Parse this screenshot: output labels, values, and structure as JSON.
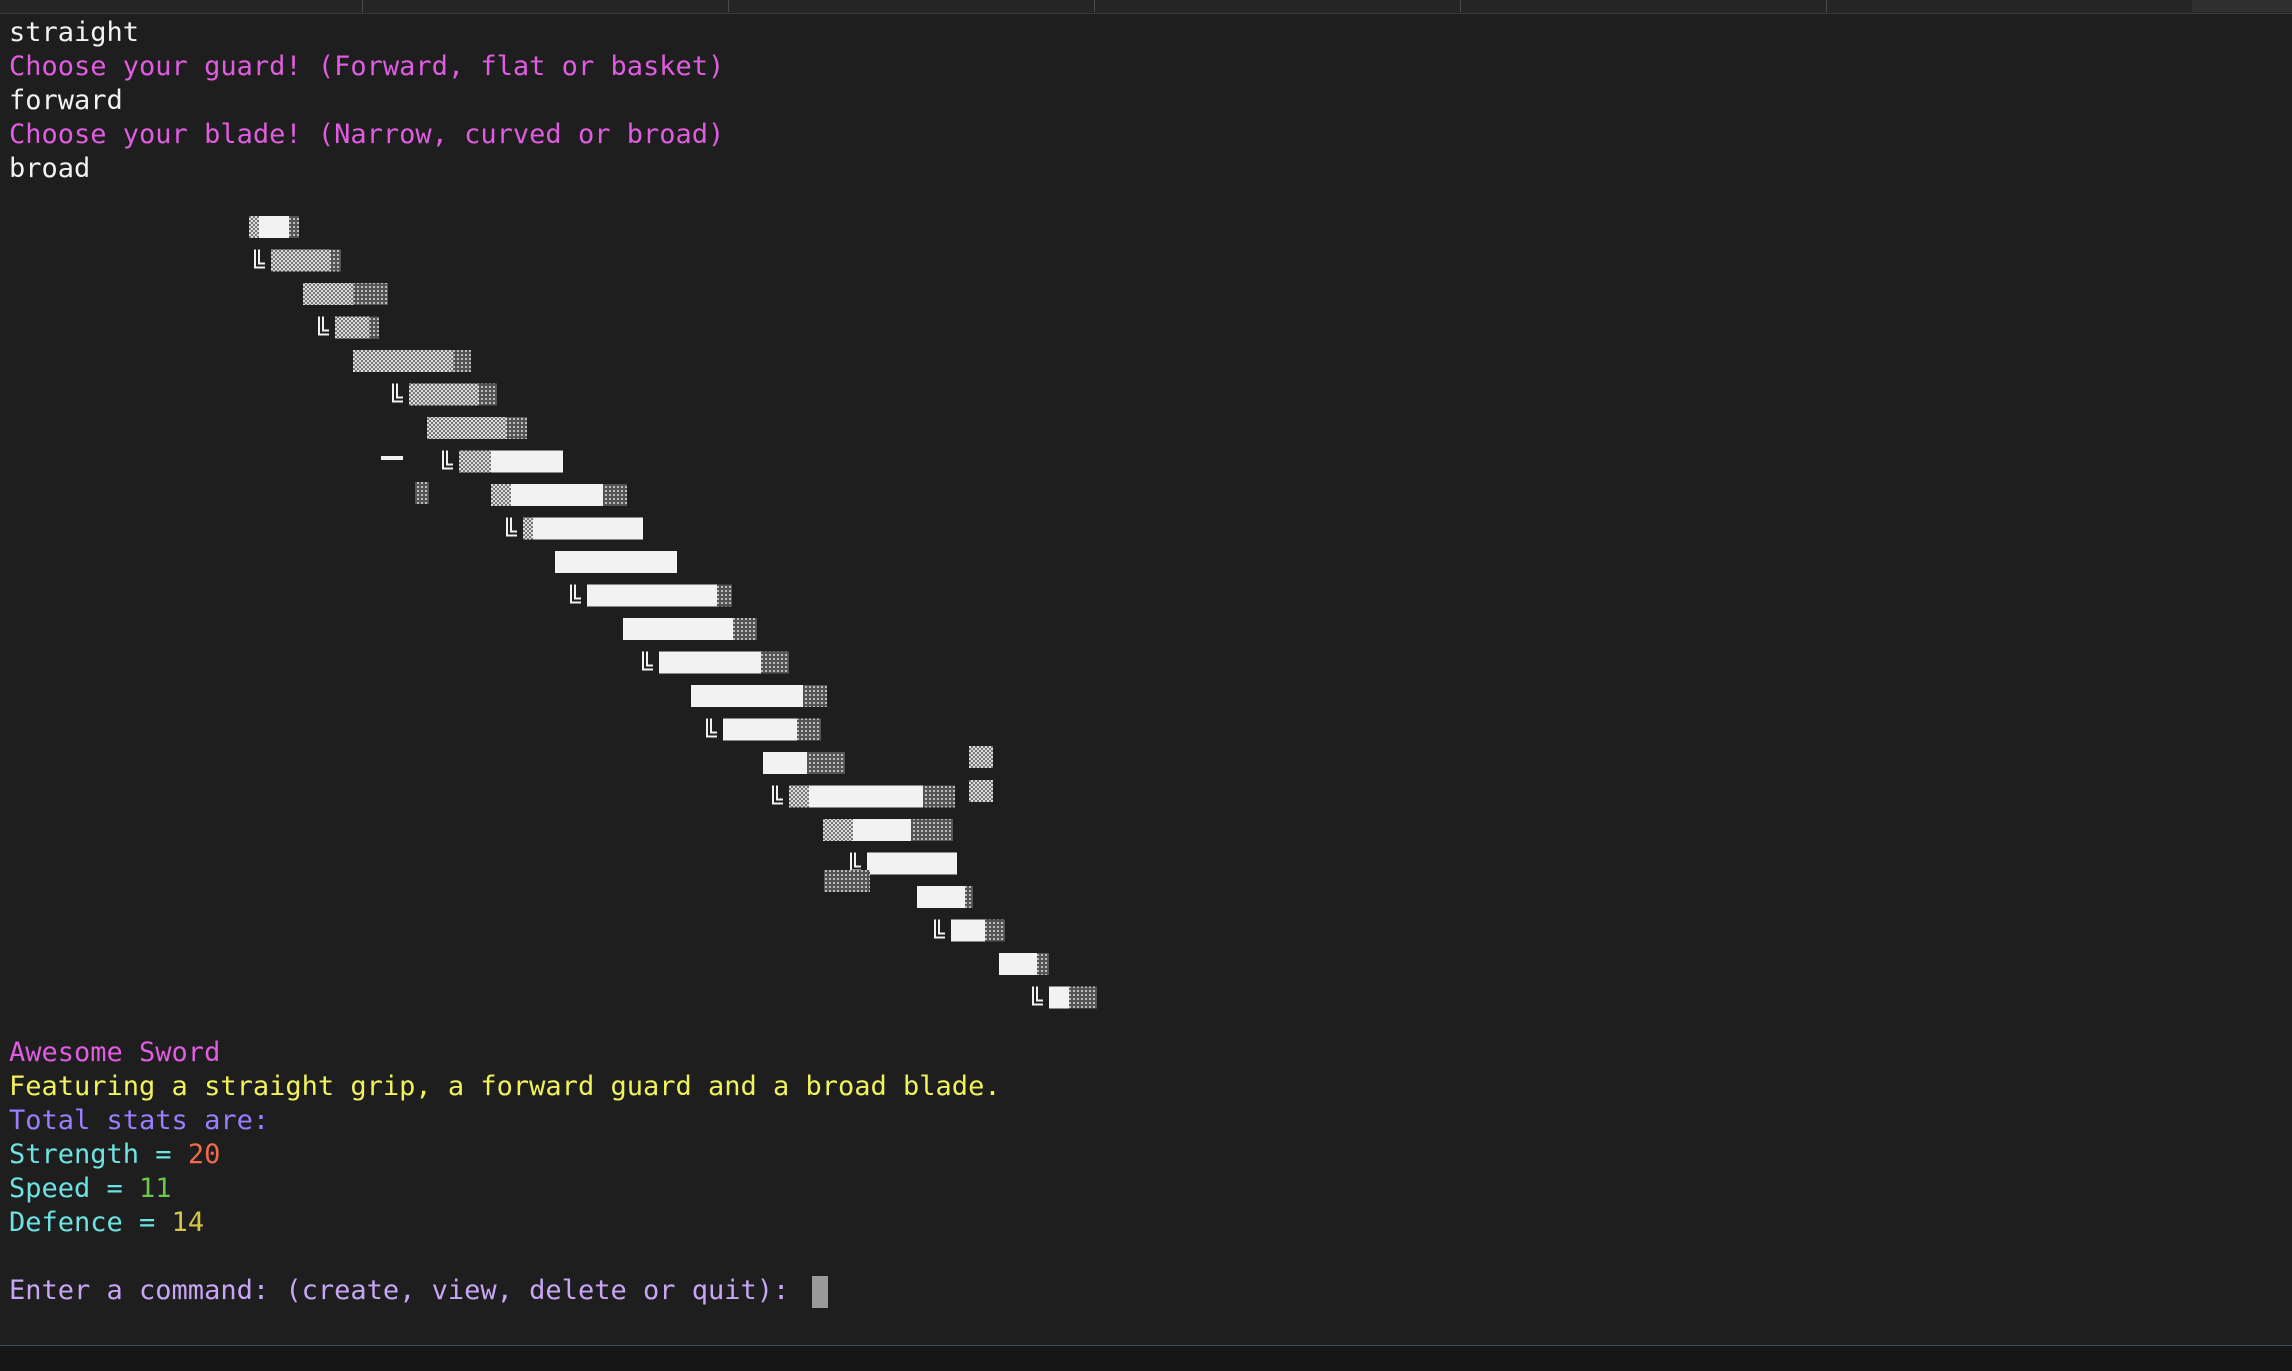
{
  "terminal": {
    "lines_top": [
      {
        "text": "straight",
        "color": "#f2f2f2"
      },
      {
        "text": "Choose your guard! (Forward, flat or basket)",
        "color": "#e05ce0"
      },
      {
        "text": "forward",
        "color": "#f2f2f2"
      },
      {
        "text": "Choose your blade! (Narrow, curved or broad)",
        "color": "#e05ce0"
      },
      {
        "text": "broad",
        "color": "#f2f2f2"
      }
    ],
    "sword_name": "Awesome Sword",
    "description": "Featuring a straight grip, a forward guard and a broad blade.",
    "stats_header": "Total stats are:",
    "stats": [
      {
        "label": "Strength = ",
        "value": "20",
        "value_color": "#f06b4d"
      },
      {
        "label": "Speed = ",
        "value": "11",
        "value_color": "#6cc64b"
      },
      {
        "label": "Defence = ",
        "value": "14",
        "value_color": "#d4c64a"
      }
    ],
    "prompt": "Enter a command: (create, view, delete or quit): "
  },
  "colors": {
    "background": "#1e1e1e",
    "default_text": "#f2f2f2",
    "prompt_magenta": "#e05ce0",
    "description_yellow": "#f2f25c",
    "stats_header_violet": "#9b7dff",
    "stat_label_cyan": "#6ee3e3",
    "command_prompt_lilac": "#c9a6f5"
  },
  "icons": {
    "cursor": "block-cursor-icon"
  }
}
